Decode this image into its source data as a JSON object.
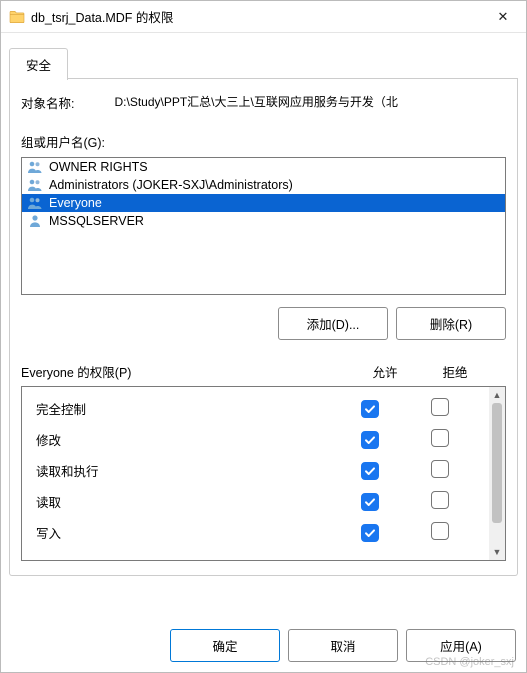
{
  "window": {
    "title": "db_tsrj_Data.MDF 的权限",
    "close_glyph": "✕"
  },
  "tabs": {
    "security": "安全"
  },
  "object": {
    "label": "对象名称:",
    "path": "D:\\Study\\PPT汇总\\大三上\\互联网应用服务与开发（北"
  },
  "groups": {
    "label": "组或用户名(G):",
    "items": [
      {
        "name": "OWNER RIGHTS",
        "selected": false,
        "kind": "group"
      },
      {
        "name": "Administrators (JOKER-SXJ\\Administrators)",
        "selected": false,
        "kind": "group"
      },
      {
        "name": "Everyone",
        "selected": true,
        "kind": "group"
      },
      {
        "name": "MSSQLSERVER",
        "selected": false,
        "kind": "user"
      }
    ]
  },
  "buttons": {
    "add": "添加(D)...",
    "remove": "删除(R)",
    "ok": "确定",
    "cancel": "取消",
    "apply": "应用(A)"
  },
  "permissions": {
    "header_label": "Everyone 的权限(P)",
    "allow_col": "允许",
    "deny_col": "拒绝",
    "rows": [
      {
        "name": "完全控制",
        "allow": true,
        "deny": false
      },
      {
        "name": "修改",
        "allow": true,
        "deny": false
      },
      {
        "name": "读取和执行",
        "allow": true,
        "deny": false
      },
      {
        "name": "读取",
        "allow": true,
        "deny": false
      },
      {
        "name": "写入",
        "allow": true,
        "deny": false
      }
    ]
  },
  "watermark": "CSDN @joker_sxj"
}
